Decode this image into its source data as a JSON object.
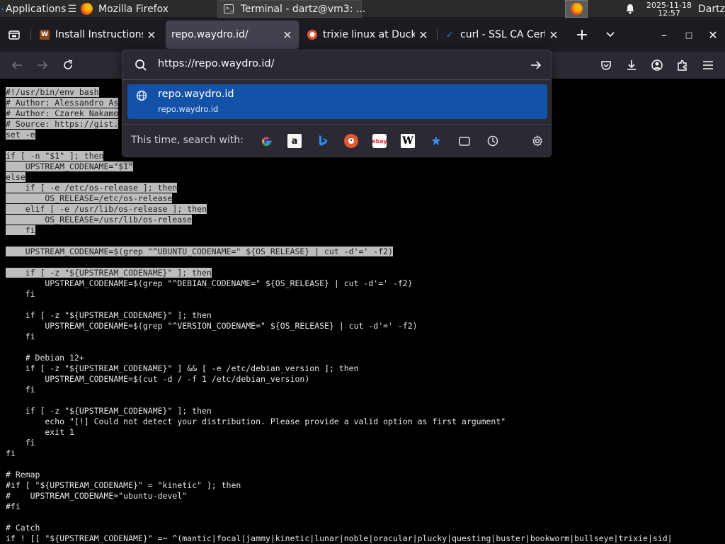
{
  "system_panel": {
    "applications_label": "Applications",
    "tasks": [
      {
        "label": "Mozilla Firefox"
      },
      {
        "label": "Terminal - dartz@vm3: ..."
      }
    ],
    "clock_date": "2025-11-18",
    "clock_time": "12:57",
    "user": "Dartz"
  },
  "browser": {
    "tabs": [
      {
        "title": "Install Instructions | W",
        "favicon": "W",
        "active": false
      },
      {
        "title": "repo.waydro.id/",
        "active": true
      },
      {
        "title": "trixie linux at DuckDuckGo",
        "active": false
      },
      {
        "title": "curl - SSL CA Certificates",
        "active": false
      }
    ],
    "new_tab": "+",
    "list_all_tabs": "⌄",
    "window_controls": {
      "minimize": "–",
      "maximize": "□",
      "close": "✕"
    }
  },
  "urlbar": {
    "value": "https://repo.waydro.id/",
    "suggestion_title": "repo.waydro.id",
    "suggestion_url": "repo.waydro.id",
    "search_with_label": "This time, search with:",
    "engines": [
      "google-icon",
      "amazon-icon",
      "bing-icon",
      "duckduckgo-icon",
      "ebay-icon",
      "wikipedia-icon",
      "bookmarks-icon",
      "tabs-icon",
      "history-icon"
    ],
    "ebay_text": "ebay",
    "wikipedia_text": "W",
    "amazon_text": "a"
  },
  "code_lines": [
    {
      "text": "#!/usr/bin/env bash",
      "hl": 19
    },
    {
      "text": "# Author: Alessandro As",
      "hl": 23
    },
    {
      "text": "# Author: Czarek Nakamo",
      "hl": 23
    },
    {
      "text": "# Source: https://gist.",
      "hl": 23
    },
    {
      "text": "set -e",
      "hl": 6
    },
    {
      "text": "",
      "hl": 0
    },
    {
      "text": "if [ -n \"$1\" ]; then",
      "hl": 20
    },
    {
      "text": "    UPSTREAM_CODENAME=\"$1\"",
      "hl": 26
    },
    {
      "text": "else",
      "hl": 4
    },
    {
      "text": "    if [ -e /etc/os-release ]; then",
      "hl": 35
    },
    {
      "text": "        OS_RELEASE=/etc/os-release",
      "hl": 34
    },
    {
      "text": "    elif [ -e /usr/lib/os-release ]; then",
      "hl": 41
    },
    {
      "text": "        OS_RELEASE=/usr/lib/os-release",
      "hl": 38
    },
    {
      "text": "    fi",
      "hl": 6
    },
    {
      "text": "",
      "hl": 0
    },
    {
      "text": "    UPSTREAM_CODENAME=$(grep \"^UBUNTU_CODENAME=\" ${OS_RELEASE} | cut -d'=' -f2)",
      "hl": 81
    },
    {
      "text": "",
      "hl": 0
    },
    {
      "text": "    if [ -z \"${UPSTREAM_CODENAME}\" ]; then",
      "hl": 42
    },
    {
      "text": "        UPSTREAM_CODENAME=$(grep \"^DEBIAN_CODENAME=\" ${OS_RELEASE} | cut -d'=' -f2)",
      "hl": 0
    },
    {
      "text": "    fi",
      "hl": 0
    },
    {
      "text": "",
      "hl": 0
    },
    {
      "text": "    if [ -z \"${UPSTREAM_CODENAME}\" ]; then",
      "hl": 0
    },
    {
      "text": "        UPSTREAM_CODENAME=$(grep \"^VERSION_CODENAME=\" ${OS_RELEASE} | cut -d'=' -f2)",
      "hl": 0
    },
    {
      "text": "    fi",
      "hl": 0
    },
    {
      "text": "",
      "hl": 0
    },
    {
      "text": "    # Debian 12+",
      "hl": 0
    },
    {
      "text": "    if [ -z \"${UPSTREAM_CODENAME}\" ] && [ -e /etc/debian_version ]; then",
      "hl": 0
    },
    {
      "text": "        UPSTREAM_CODENAME=$(cut -d / -f 1 /etc/debian_version)",
      "hl": 0
    },
    {
      "text": "    fi",
      "hl": 0
    },
    {
      "text": "",
      "hl": 0
    },
    {
      "text": "    if [ -z \"${UPSTREAM_CODENAME}\" ]; then",
      "hl": 0
    },
    {
      "text": "        echo \"[!] Could not detect your distribution. Please provide a valid option as first argument\"",
      "hl": 0
    },
    {
      "text": "        exit 1",
      "hl": 0
    },
    {
      "text": "    fi",
      "hl": 0
    },
    {
      "text": "fi",
      "hl": 0
    },
    {
      "text": "",
      "hl": 0
    },
    {
      "text": "# Remap",
      "hl": 0
    },
    {
      "text": "#if [ \"${UPSTREAM_CODENAME}\" = \"kinetic\" ]; then",
      "hl": 0
    },
    {
      "text": "#    UPSTREAM_CODENAME=\"ubuntu-devel\"",
      "hl": 0
    },
    {
      "text": "#fi",
      "hl": 0
    },
    {
      "text": "",
      "hl": 0
    },
    {
      "text": "# Catch",
      "hl": 0
    },
    {
      "text": "if ! [[ \"${UPSTREAM_CODENAME}\" =~ ^(mantic|focal|jammy|kinetic|lunar|noble|oracular|plucky|questing|buster|bookworm|bullseye|trixie|sid|",
      "hl": 0
    }
  ]
}
